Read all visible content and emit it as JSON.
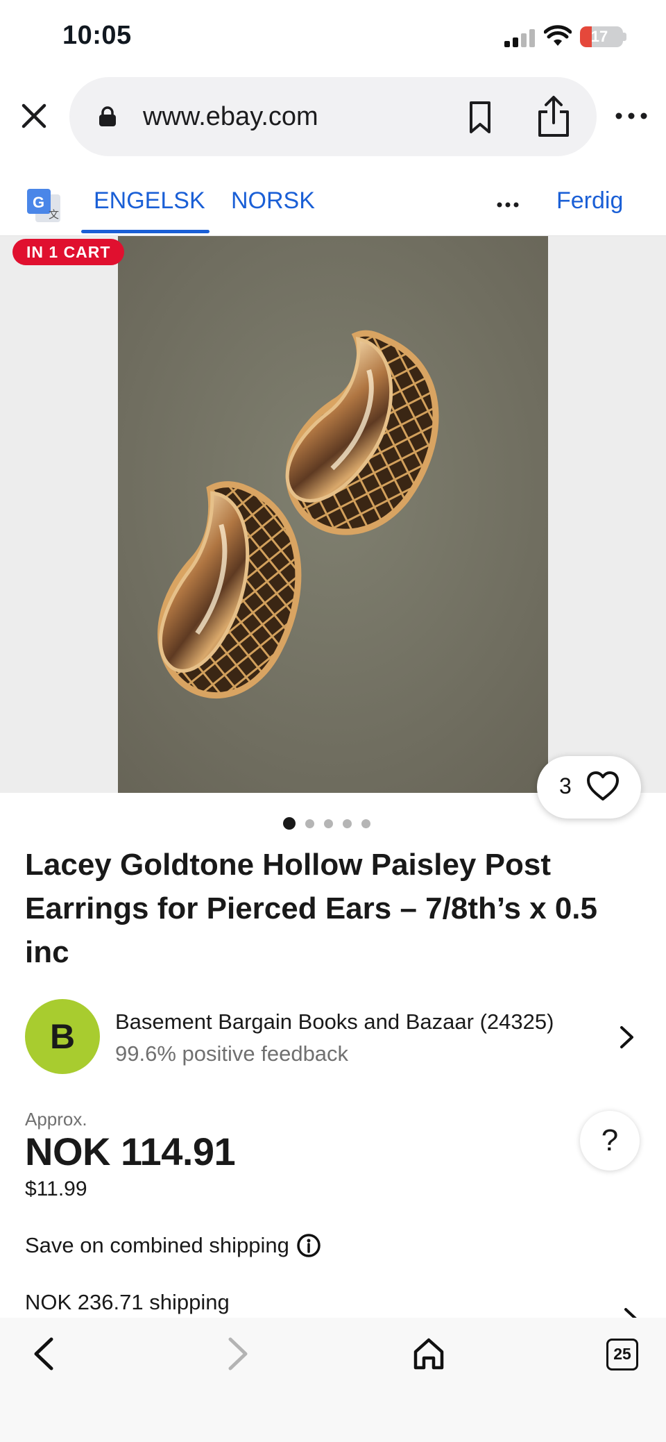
{
  "status_bar": {
    "time": "10:05",
    "battery": "17",
    "battery_level": 0.17
  },
  "browser": {
    "url": "www.ebay.com",
    "icons": [
      "close-icon",
      "lock-icon",
      "bookmark-icon",
      "share-icon",
      "more-icon"
    ]
  },
  "translate": {
    "tab_source": "ENGELSK",
    "tab_target": "NORSK",
    "done_label": "Ferdig"
  },
  "listing": {
    "cart_badge": "IN 1 CART",
    "watch_count": "3",
    "image_count": 5,
    "active_image": 1,
    "title": "Lacey Goldtone Hollow Paisley Post Earrings for Pierced Ears – 7/8th’s x 0.5 inc",
    "seller": {
      "avatar_letter": "B",
      "name": "Basement Bargain Books and Bazaar (24325)",
      "feedback": "99.6% positive feedback"
    },
    "price": {
      "approx_label": "Approx.",
      "local": "NOK 114.91",
      "usd": "$11.99"
    },
    "combined_shipping": "Save on combined shipping",
    "shipping": "NOK 236.71 shipping",
    "help_label": "?"
  },
  "toolbar": {
    "tabs_count": "25"
  },
  "colors": {
    "link_blue": "#1a5fd6",
    "badge_red": "#e0102f",
    "avatar_green": "#a8cc2f"
  }
}
